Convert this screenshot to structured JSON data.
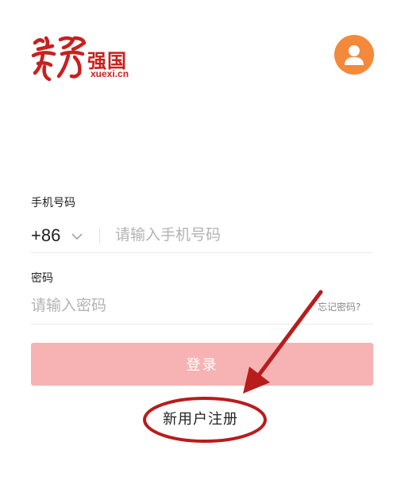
{
  "logo": {
    "text_cn": "强国",
    "domain": "xuexi.cn",
    "calligraphy": "學習"
  },
  "user": {
    "avatar_icon": "user-avatar-icon"
  },
  "phone": {
    "label": "手机号码",
    "country_code": "+86",
    "placeholder": "请输入手机号码"
  },
  "password": {
    "label": "密码",
    "placeholder": "请输入密码",
    "forgot_label": "忘记密码?"
  },
  "login": {
    "label": "登录"
  },
  "register": {
    "label": "新用户注册"
  },
  "colors": {
    "brand_red": "#c8201f",
    "avatar_orange": "#f3893b",
    "login_button": "#f7b3b3",
    "annotation_red": "#b81c1c"
  }
}
